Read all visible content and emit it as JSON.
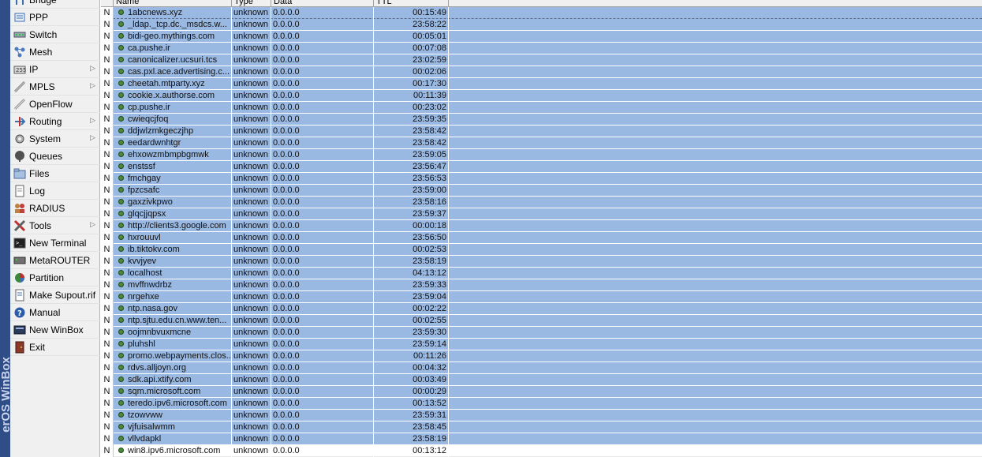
{
  "sidebar": {
    "vertical_text": "erOS WinBox",
    "items": [
      {
        "label": "Bridge",
        "icon": "bridge-icon",
        "submenu": false
      },
      {
        "label": "PPP",
        "icon": "ppp-icon",
        "submenu": false
      },
      {
        "label": "Switch",
        "icon": "switch-icon",
        "submenu": false
      },
      {
        "label": "Mesh",
        "icon": "mesh-icon",
        "submenu": false
      },
      {
        "label": "IP",
        "icon": "ip-icon",
        "submenu": true
      },
      {
        "label": "MPLS",
        "icon": "mpls-icon",
        "submenu": true
      },
      {
        "label": "OpenFlow",
        "icon": "openflow-icon",
        "submenu": false
      },
      {
        "label": "Routing",
        "icon": "routing-icon",
        "submenu": true
      },
      {
        "label": "System",
        "icon": "system-icon",
        "submenu": true
      },
      {
        "label": "Queues",
        "icon": "queues-icon",
        "submenu": false
      },
      {
        "label": "Files",
        "icon": "files-icon",
        "submenu": false
      },
      {
        "label": "Log",
        "icon": "log-icon",
        "submenu": false
      },
      {
        "label": "RADIUS",
        "icon": "radius-icon",
        "submenu": false
      },
      {
        "label": "Tools",
        "icon": "tools-icon",
        "submenu": true
      },
      {
        "label": "New Terminal",
        "icon": "terminal-icon",
        "submenu": false
      },
      {
        "label": "MetaROUTER",
        "icon": "metarouter-icon",
        "submenu": false
      },
      {
        "label": "Partition",
        "icon": "partition-icon",
        "submenu": false
      },
      {
        "label": "Make Supout.rif",
        "icon": "supout-icon",
        "submenu": false
      },
      {
        "label": "Manual",
        "icon": "manual-icon",
        "submenu": false
      },
      {
        "label": "New WinBox",
        "icon": "winbox-icon",
        "submenu": false
      },
      {
        "label": "Exit",
        "icon": "exit-icon",
        "submenu": false
      }
    ]
  },
  "table": {
    "columns": [
      "Name",
      "Type",
      "Data",
      "TTL"
    ],
    "rows": [
      {
        "flag": "N",
        "name": "1abcnews.xyz",
        "type": "unknown",
        "data": "0.0.0.0",
        "ttl": "00:15:49"
      },
      {
        "flag": "N",
        "name": "_ldap._tcp.dc._msdcs.w...",
        "type": "unknown",
        "data": "0.0.0.0",
        "ttl": "23:58:22"
      },
      {
        "flag": "N",
        "name": "bidi-geo.mythings.com",
        "type": "unknown",
        "data": "0.0.0.0",
        "ttl": "00:05:01"
      },
      {
        "flag": "N",
        "name": "ca.pushe.ir",
        "type": "unknown",
        "data": "0.0.0.0",
        "ttl": "00:07:08"
      },
      {
        "flag": "N",
        "name": "canonicalizer.ucsuri.tcs",
        "type": "unknown",
        "data": "0.0.0.0",
        "ttl": "23:02:59"
      },
      {
        "flag": "N",
        "name": "cas.pxl.ace.advertising.c...",
        "type": "unknown",
        "data": "0.0.0.0",
        "ttl": "00:02:06"
      },
      {
        "flag": "N",
        "name": "cheetah.mtparty.xyz",
        "type": "unknown",
        "data": "0.0.0.0",
        "ttl": "00:17:30"
      },
      {
        "flag": "N",
        "name": "cookie.x.authorse.com",
        "type": "unknown",
        "data": "0.0.0.0",
        "ttl": "00:11:39"
      },
      {
        "flag": "N",
        "name": "cp.pushe.ir",
        "type": "unknown",
        "data": "0.0.0.0",
        "ttl": "00:23:02"
      },
      {
        "flag": "N",
        "name": "cwieqcjfoq",
        "type": "unknown",
        "data": "0.0.0.0",
        "ttl": "23:59:35"
      },
      {
        "flag": "N",
        "name": "ddjwlzmkgeczjhp",
        "type": "unknown",
        "data": "0.0.0.0",
        "ttl": "23:58:42"
      },
      {
        "flag": "N",
        "name": "eedardwnhtgr",
        "type": "unknown",
        "data": "0.0.0.0",
        "ttl": "23:58:42"
      },
      {
        "flag": "N",
        "name": "ehxowzmbmpbgmwk",
        "type": "unknown",
        "data": "0.0.0.0",
        "ttl": "23:59:05"
      },
      {
        "flag": "N",
        "name": "enstssf",
        "type": "unknown",
        "data": "0.0.0.0",
        "ttl": "23:56:47"
      },
      {
        "flag": "N",
        "name": "fmchgay",
        "type": "unknown",
        "data": "0.0.0.0",
        "ttl": "23:56:53"
      },
      {
        "flag": "N",
        "name": "fpzcsafc",
        "type": "unknown",
        "data": "0.0.0.0",
        "ttl": "23:59:00"
      },
      {
        "flag": "N",
        "name": "gaxzivkpwo",
        "type": "unknown",
        "data": "0.0.0.0",
        "ttl": "23:58:16"
      },
      {
        "flag": "N",
        "name": "glqcjjqpsx",
        "type": "unknown",
        "data": "0.0.0.0",
        "ttl": "23:59:37"
      },
      {
        "flag": "N",
        "name": "http://clients3.google.com",
        "type": "unknown",
        "data": "0.0.0.0",
        "ttl": "00:00:18"
      },
      {
        "flag": "N",
        "name": "hxrouuvl",
        "type": "unknown",
        "data": "0.0.0.0",
        "ttl": "23:56:50"
      },
      {
        "flag": "N",
        "name": "ib.tiktokv.com",
        "type": "unknown",
        "data": "0.0.0.0",
        "ttl": "00:02:53"
      },
      {
        "flag": "N",
        "name": "kvvjyev",
        "type": "unknown",
        "data": "0.0.0.0",
        "ttl": "23:58:19"
      },
      {
        "flag": "N",
        "name": "localhost",
        "type": "unknown",
        "data": "0.0.0.0",
        "ttl": "04:13:12"
      },
      {
        "flag": "N",
        "name": "mvffnwdrbz",
        "type": "unknown",
        "data": "0.0.0.0",
        "ttl": "23:59:33"
      },
      {
        "flag": "N",
        "name": "nrgehxe",
        "type": "unknown",
        "data": "0.0.0.0",
        "ttl": "23:59:04"
      },
      {
        "flag": "N",
        "name": "ntp.nasa.gov",
        "type": "unknown",
        "data": "0.0.0.0",
        "ttl": "00:02:22"
      },
      {
        "flag": "N",
        "name": "ntp.sjtu.edu.cn.www.ten...",
        "type": "unknown",
        "data": "0.0.0.0",
        "ttl": "00:02:55"
      },
      {
        "flag": "N",
        "name": "oojmnbvuxmcne",
        "type": "unknown",
        "data": "0.0.0.0",
        "ttl": "23:59:30"
      },
      {
        "flag": "N",
        "name": "pluhshl",
        "type": "unknown",
        "data": "0.0.0.0",
        "ttl": "23:59:14"
      },
      {
        "flag": "N",
        "name": "promo.webpayments.clos...",
        "type": "unknown",
        "data": "0.0.0.0",
        "ttl": "00:11:26"
      },
      {
        "flag": "N",
        "name": "rdvs.alljoyn.org",
        "type": "unknown",
        "data": "0.0.0.0",
        "ttl": "00:04:32"
      },
      {
        "flag": "N",
        "name": "sdk.api.xtify.com",
        "type": "unknown",
        "data": "0.0.0.0",
        "ttl": "00:03:49"
      },
      {
        "flag": "N",
        "name": "sqm.microsoft.com",
        "type": "unknown",
        "data": "0.0.0.0",
        "ttl": "00:00:29"
      },
      {
        "flag": "N",
        "name": "teredo.ipv6.microsoft.com",
        "type": "unknown",
        "data": "0.0.0.0",
        "ttl": "00:13:52"
      },
      {
        "flag": "N",
        "name": "tzowvww",
        "type": "unknown",
        "data": "0.0.0.0",
        "ttl": "23:59:31"
      },
      {
        "flag": "N",
        "name": "vjfuisalwmm",
        "type": "unknown",
        "data": "0.0.0.0",
        "ttl": "23:58:45"
      },
      {
        "flag": "N",
        "name": "vllvdapkl",
        "type": "unknown",
        "data": "0.0.0.0",
        "ttl": "23:58:19"
      },
      {
        "flag": "N",
        "name": "win8.ipv6.microsoft.com",
        "type": "unknown",
        "data": "0.0.0.0",
        "ttl": "00:13:12"
      }
    ]
  },
  "colors": {
    "selected_row": "#99b8e2",
    "sidebar_bg": "#f0f0f0",
    "vertical_bar": "#2f4d86"
  }
}
